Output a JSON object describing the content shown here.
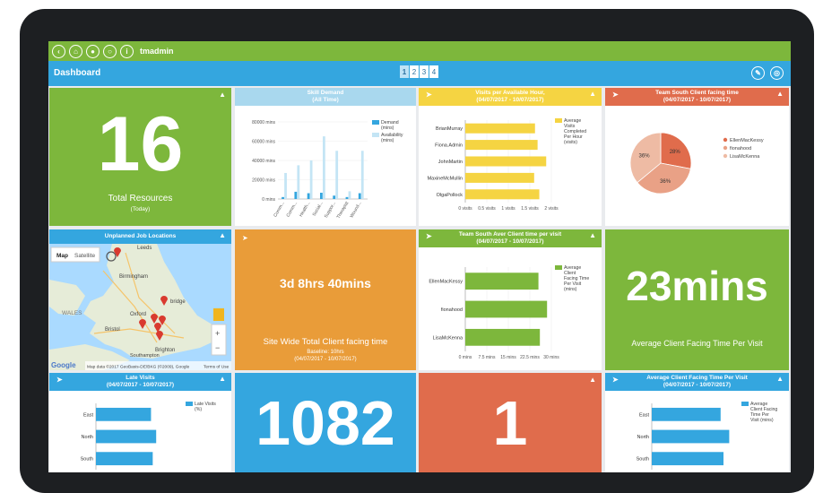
{
  "appbar": {
    "user": "tmadmin"
  },
  "dashbar": {
    "title": "Dashboard",
    "pages": [
      "1",
      "2",
      "3",
      "4"
    ],
    "active_page": 1
  },
  "tiles": {
    "total_resources": {
      "value": "16",
      "label": "Total Resources",
      "sublabel": "(Today)"
    },
    "skill_demand": {
      "title": "Skill Demand",
      "subtitle": "(All Time)"
    },
    "visits_per_hour": {
      "title": "Visits per Available Hour,",
      "subtitle": "(04/07/2017 - 10/07/2017)"
    },
    "south_client_time": {
      "title": "Team South Client facing time",
      "subtitle": "(04/07/2017 - 10/07/2017)"
    },
    "unplanned_jobs": {
      "title": "Unplanned Job Locations",
      "map_tab": "Map",
      "satellite_tab": "Satellite",
      "places": [
        "Leeds",
        "WALES",
        "Oxford",
        "Bristol",
        "Brighton",
        "Southampton",
        "Birmingham",
        "bridge"
      ],
      "zoom_in": "+",
      "zoom_out": "−",
      "google": "Google",
      "attribution": "Map data ©2017 GeoBasis-DE/BKG (©2009), Google",
      "terms": "Terms of Use"
    },
    "site_wide": {
      "value": "3d 8hrs 40mins",
      "label": "Site Wide Total Client facing time",
      "baseline": "Baseline: 10hrs",
      "range": "(04/07/2017 - 10/07/2017)"
    },
    "south_avg": {
      "title": "Team South Aver Client time per visit",
      "subtitle": "(04/07/2017 - 10/07/2017)"
    },
    "avg_minutes": {
      "value": "23mins",
      "label": "Average Client Facing Time Per Visit"
    },
    "late_visits": {
      "title": "Late Visits",
      "subtitle": "(04/07/2017 - 10/07/2017)"
    },
    "count_1082": {
      "value": "1082"
    },
    "count_1": {
      "value": "1"
    },
    "avg_time_per_visit": {
      "title": "Average Client Facing Time Per Visit",
      "subtitle": "(04/07/2017 - 10/07/2017)"
    }
  },
  "colors": {
    "green": "#7db73c",
    "blue": "#34a6df",
    "orange": "#e99c39",
    "red": "#e06c4c",
    "yellow": "#f5d442",
    "lightblue": "#a9d8ee",
    "lightred": "#e8725a"
  },
  "chart_data": [
    {
      "id": "skill_demand",
      "type": "bar",
      "categories": [
        "Comm...",
        "Comm...",
        "Health...",
        "Social...",
        "Suppor...",
        "Therapist",
        "Wound..."
      ],
      "series": [
        {
          "name": "Demand (mins)",
          "values": [
            2000,
            7500,
            6000,
            6500,
            3500,
            2000,
            6000
          ]
        },
        {
          "name": "Availability (mins)",
          "values": [
            27000,
            35000,
            40000,
            65000,
            50000,
            8000,
            50000
          ]
        }
      ],
      "yticks": [
        "0 mins",
        "20000 mins",
        "40000 mins",
        "60000 mins",
        "80000 mins"
      ],
      "ylim": [
        0,
        80000
      ]
    },
    {
      "id": "visits_per_hour",
      "type": "bar",
      "orientation": "horizontal",
      "categories": [
        "BrianMurray",
        "Fiona.Admin",
        "JohnMartin",
        "MaxineMcMullin",
        "OlgaPollock"
      ],
      "series": [
        {
          "name": "Average Visits Completed Per Hour (visits)",
          "values": [
            1.62,
            1.68,
            1.88,
            1.6,
            1.72
          ]
        }
      ],
      "xticks": [
        "0 visits",
        "0.5 visits",
        "1 visits",
        "1.5 visits",
        "2 visits"
      ],
      "xlim": [
        0,
        2
      ]
    },
    {
      "id": "south_client_time",
      "type": "pie",
      "categories": [
        "EllenMacKessy",
        "fionahood",
        "LisaMcKenna"
      ],
      "values": [
        28,
        36,
        36
      ],
      "labels": [
        "28%",
        "36%",
        "36%"
      ]
    },
    {
      "id": "south_avg",
      "type": "bar",
      "orientation": "horizontal",
      "categories": [
        "EllenMacKessy",
        "fionahood",
        "LisaMcKenna"
      ],
      "series": [
        {
          "name": "Average Client Facing Time Per Visit (mins)",
          "values": [
            25.5,
            28.5,
            26
          ]
        }
      ],
      "xticks": [
        "0 mins",
        "7.5 mins",
        "15 mins",
        "22.5 mins",
        "30 mins"
      ],
      "xlim": [
        0,
        30
      ]
    },
    {
      "id": "late_visits",
      "type": "bar",
      "orientation": "horizontal",
      "categories": [
        "East",
        "North",
        "South"
      ],
      "series": [
        {
          "name": "Late Visits (%)",
          "values": [
            64,
            70,
            66
          ]
        }
      ],
      "xlim": [
        0,
        100
      ]
    },
    {
      "id": "avg_time_per_visit",
      "type": "bar",
      "orientation": "horizontal",
      "categories": [
        "East",
        "North",
        "South"
      ],
      "series": [
        {
          "name": "Average Client Facing Time Per Visit (mins)",
          "values": [
            24,
            27,
            25
          ]
        }
      ],
      "xlim": [
        0,
        30
      ]
    }
  ]
}
